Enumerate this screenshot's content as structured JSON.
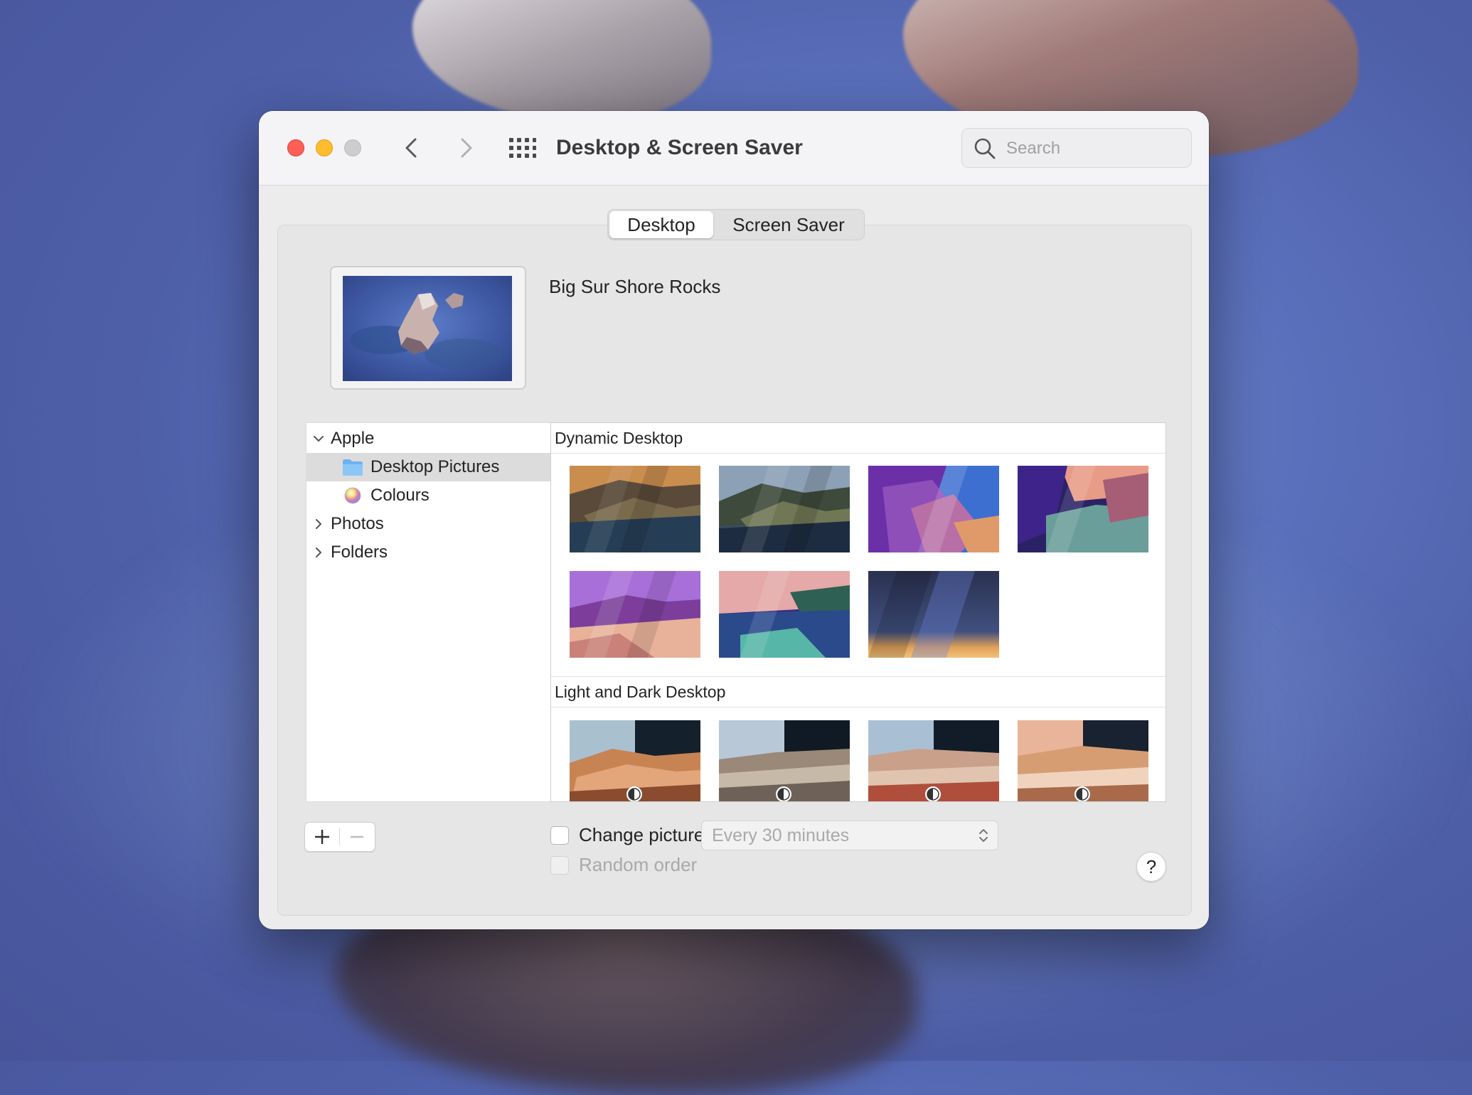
{
  "window": {
    "title": "Desktop & Screen Saver",
    "traffic_lights": [
      "close",
      "minimize",
      "zoom"
    ],
    "colors": {
      "close": "#fe5f57",
      "minimize": "#febc2e",
      "zoom": "#cdcdcd"
    }
  },
  "toolbar": {
    "back_icon": "chevron-left-icon",
    "forward_icon": "chevron-right-icon",
    "show_all_icon": "grid-icon"
  },
  "search": {
    "placeholder": "Search",
    "value": ""
  },
  "tabs": [
    {
      "label": "Desktop",
      "selected": true
    },
    {
      "label": "Screen Saver",
      "selected": false
    }
  ],
  "preview": {
    "name": "Big Sur Shore Rocks"
  },
  "sources": {
    "groups": [
      {
        "label": "Apple",
        "expanded": true,
        "children": [
          {
            "label": "Desktop Pictures",
            "icon": "folder-icon",
            "selected": true
          },
          {
            "label": "Colours",
            "icon": "color-wheel-icon",
            "selected": false
          }
        ]
      },
      {
        "label": "Photos",
        "expanded": false
      },
      {
        "label": "Folders",
        "expanded": false
      }
    ]
  },
  "gallery": {
    "sections": [
      {
        "title": "Dynamic Desktop",
        "thumbnail_count": 7
      },
      {
        "title": "Light and Dark Desktop",
        "thumbnail_count": 4
      }
    ]
  },
  "controls": {
    "add_label": "+",
    "remove_label": "—",
    "change_picture_label": "Change picture:",
    "change_picture_checked": false,
    "interval_value": "Every 30 minutes",
    "random_order_label": "Random order",
    "random_order_checked": false,
    "help_label": "?"
  }
}
